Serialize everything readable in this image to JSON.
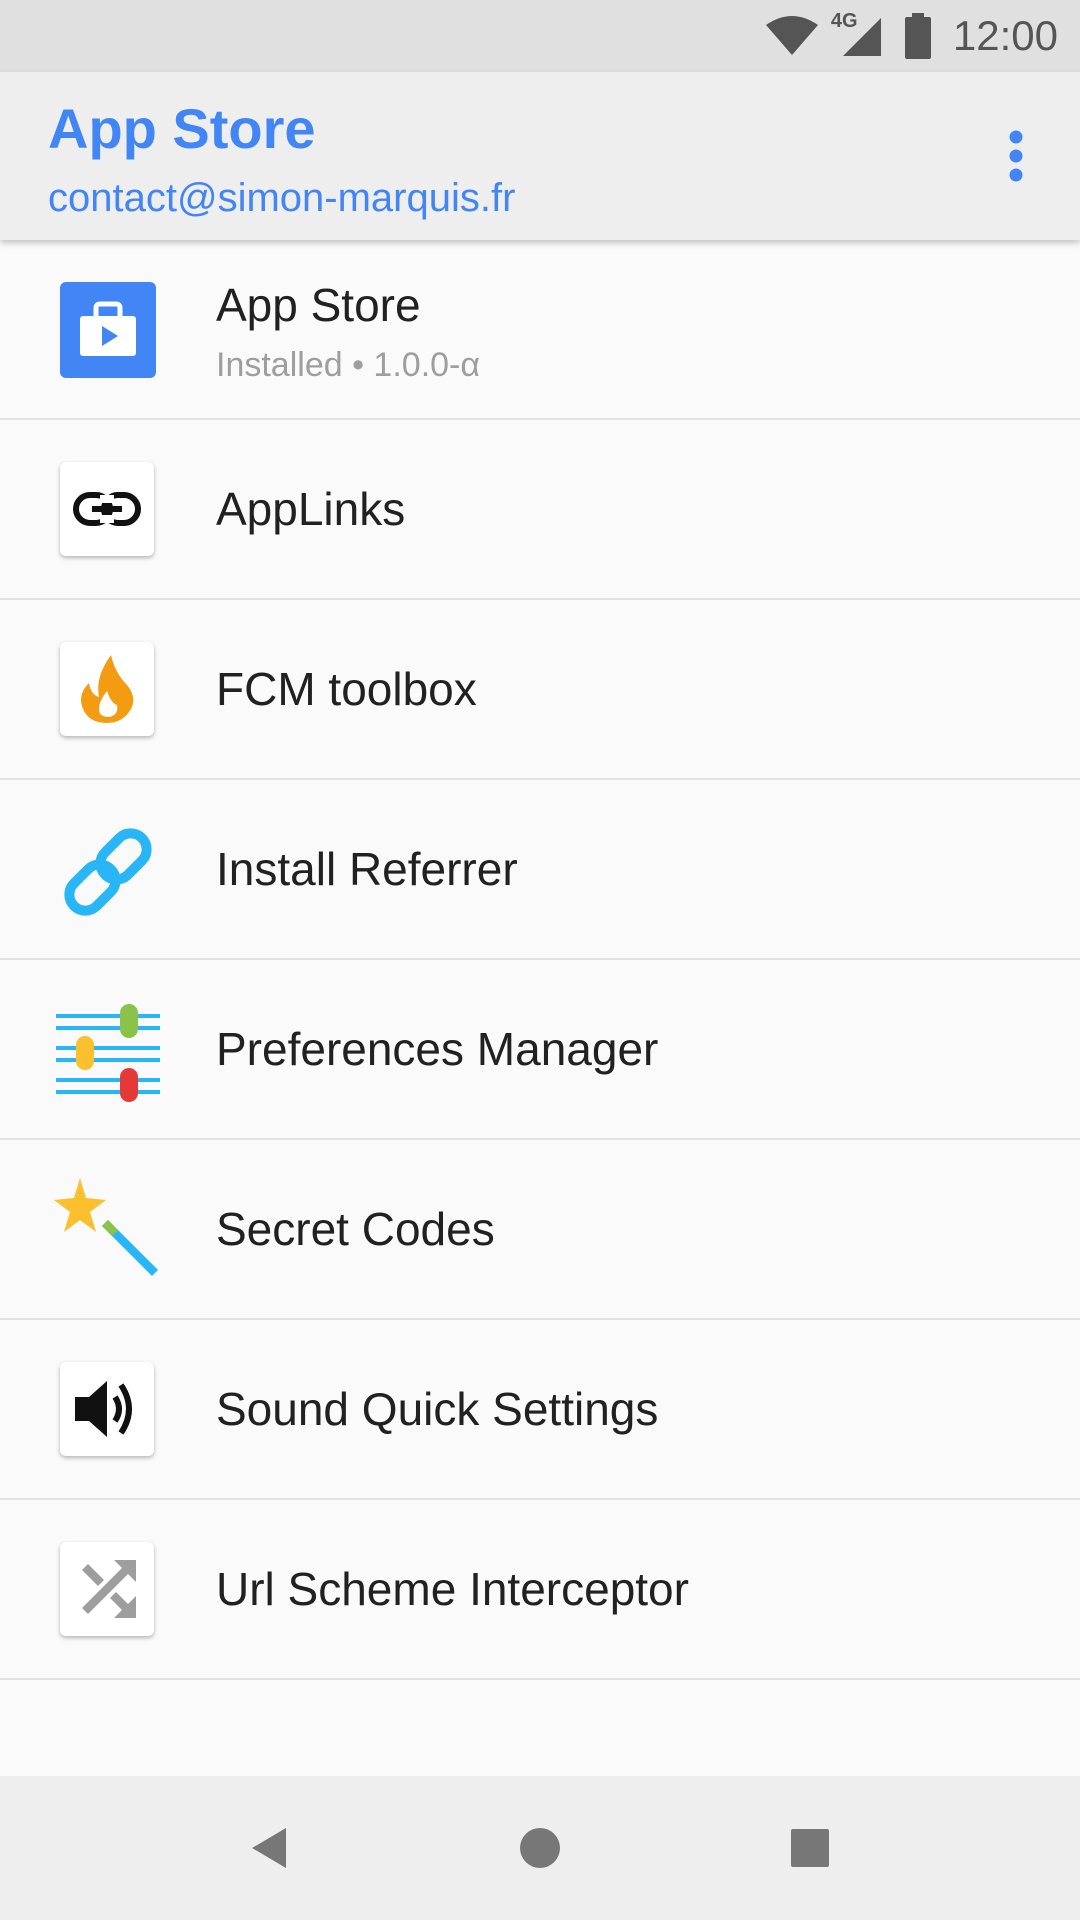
{
  "status_bar": {
    "network": "4G",
    "time": "12:00",
    "icons": [
      "wifi-icon",
      "cellular-signal-icon",
      "battery-icon"
    ]
  },
  "app_bar": {
    "title": "App Store",
    "subtitle": "contact@simon-marquis.fr",
    "overflow_icon": "more-vert-icon"
  },
  "apps": [
    {
      "name": "App Store",
      "status": "Installed • 1.0.0-α",
      "icon": "app-store-icon"
    },
    {
      "name": "AppLinks",
      "icon": "link-icon"
    },
    {
      "name": "FCM toolbox",
      "icon": "flame-icon"
    },
    {
      "name": "Install Referrer",
      "icon": "chain-link-icon"
    },
    {
      "name": "Preferences Manager",
      "icon": "sliders-icon"
    },
    {
      "name": "Secret Codes",
      "icon": "magic-wand-icon"
    },
    {
      "name": "Sound Quick Settings",
      "icon": "speaker-icon"
    },
    {
      "name": "Url Scheme Interceptor",
      "icon": "shuffle-icon"
    }
  ],
  "nav_bar": {
    "buttons": [
      "back-icon",
      "home-icon",
      "recents-icon"
    ]
  },
  "colors": {
    "accent": "#4285f4",
    "status_bar_bg": "#e0e0e0",
    "app_bar_bg": "#eeeeee",
    "list_bg": "#fafafa"
  }
}
